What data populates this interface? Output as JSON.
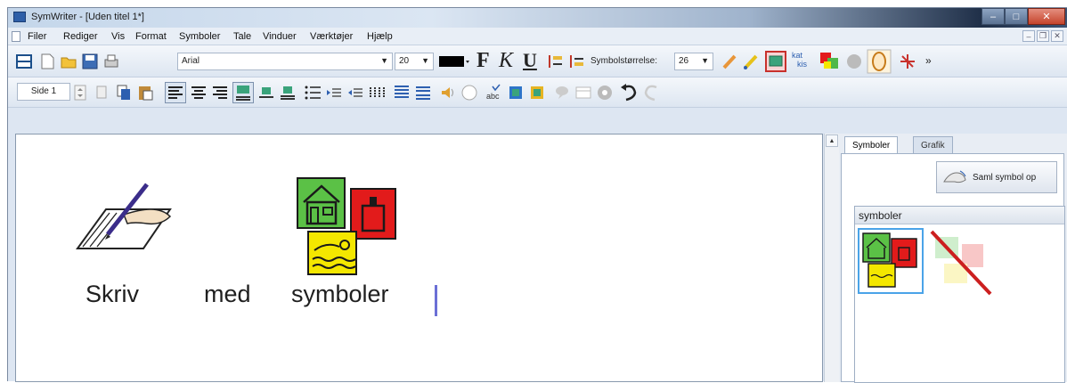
{
  "window": {
    "title": "SymWriter - [Uden titel 1*]",
    "minimize": "–",
    "maximize": "□",
    "close": "✕"
  },
  "menu": {
    "items": [
      "Filer",
      "Rediger",
      "Vis",
      "Format",
      "Symboler",
      "Tale",
      "Vinduer",
      "Værktøjer",
      "Hjælp"
    ],
    "mdi_min": "–",
    "mdi_restore": "❐",
    "mdi_close": "✕"
  },
  "toolbar1": {
    "font": "Arial",
    "font_size": "20",
    "symbol_size_label": "Symbolstørrelse:",
    "symbol_size": "26",
    "bold": "F",
    "italic": "K",
    "underline": "U",
    "more": "»",
    "swap_top": "kat",
    "swap_bottom": "kis"
  },
  "toolbar2": {
    "page": "Side 1"
  },
  "editor": {
    "words": [
      "Skriv",
      "med",
      "symboler"
    ]
  },
  "panel": {
    "tabs": [
      "Symboler",
      "Grafik"
    ],
    "collect_button": "Saml symbol op",
    "group_title": "symboler"
  },
  "colors": {
    "house_green": "#5bc146",
    "box_red": "#e21b1b",
    "swim_yellow": "#f4e700",
    "caret": "#6b6fd6",
    "selection": "#4aa3e8",
    "strike": "#cc1f1f"
  }
}
